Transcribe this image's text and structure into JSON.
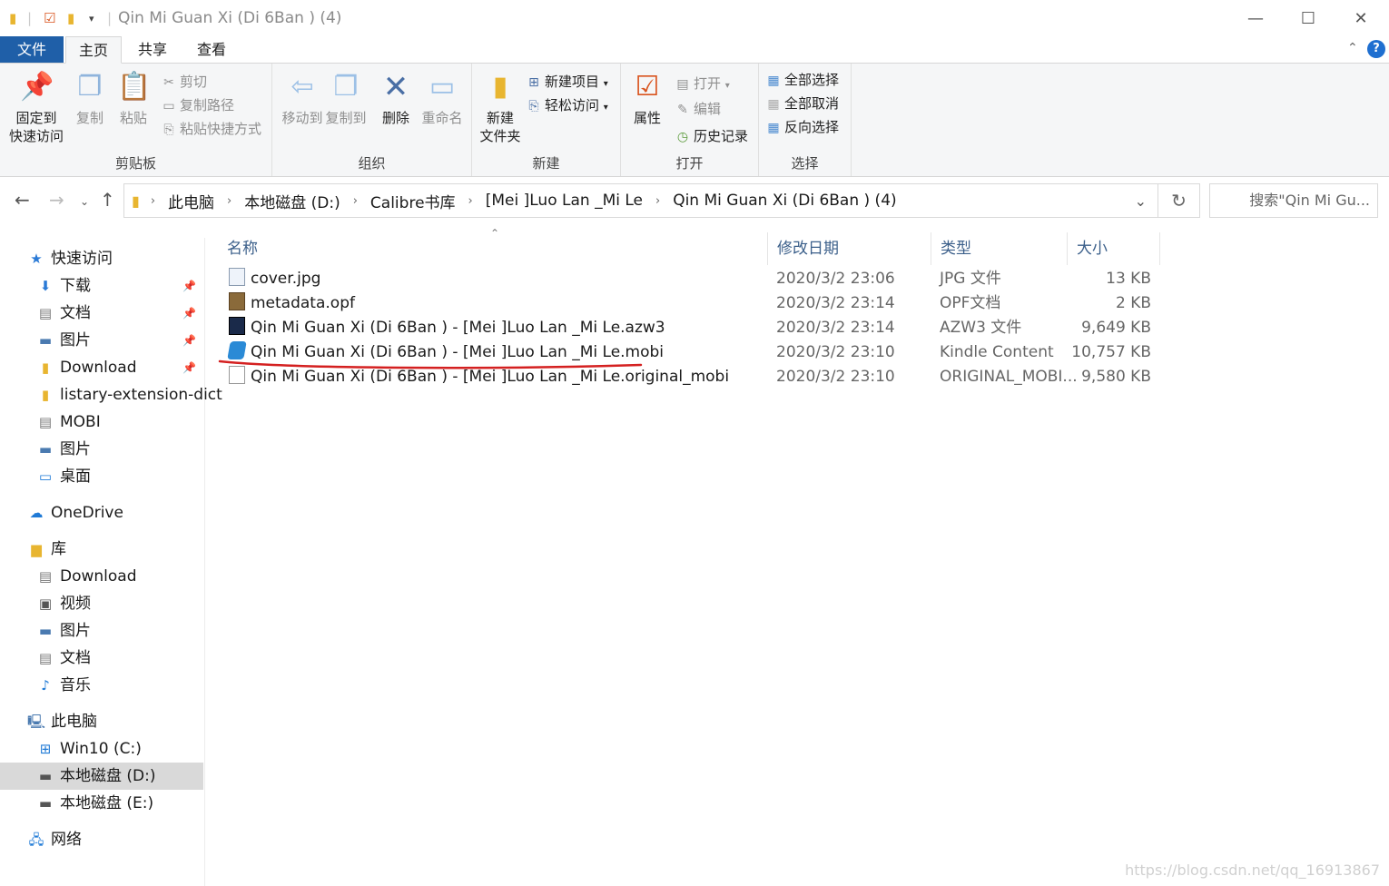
{
  "window": {
    "title": "Qin Mi Guan Xi (Di 6Ban ) (4)",
    "minimize": "—",
    "maximize": "☐",
    "close": "✕"
  },
  "tabs": {
    "file": "文件",
    "home": "主页",
    "share": "共享",
    "view": "查看"
  },
  "ribbon": {
    "clipboard": {
      "label": "剪贴板",
      "pin": "固定到\n快速访问",
      "copy": "复制",
      "paste": "粘贴",
      "cut": "剪切",
      "copy_path": "复制路径",
      "paste_shortcut": "粘贴快捷方式"
    },
    "organize": {
      "label": "组织",
      "move_to": "移动到",
      "copy_to": "复制到",
      "delete": "删除",
      "rename": "重命名"
    },
    "new": {
      "label": "新建",
      "new_folder": "新建\n文件夹",
      "new_item": "新建项目",
      "easy_access": "轻松访问"
    },
    "open": {
      "label": "打开",
      "properties": "属性",
      "open": "打开",
      "edit": "编辑",
      "history": "历史记录"
    },
    "select": {
      "label": "选择",
      "select_all": "全部选择",
      "select_none": "全部取消",
      "invert": "反向选择"
    }
  },
  "address": {
    "crumbs": [
      "此电脑",
      "本地磁盘 (D:)",
      "Calibre书库",
      "[Mei ]Luo Lan _Mi Le",
      "Qin Mi Guan Xi (Di 6Ban ) (4)"
    ],
    "search_placeholder": "搜索\"Qin Mi Gu..."
  },
  "nav": {
    "items": [
      {
        "label": "快速访问",
        "icon": "star-icon"
      },
      {
        "label": "下载",
        "icon": "download-arrow-icon"
      },
      {
        "label": "文档",
        "icon": "document-icon"
      },
      {
        "label": "图片",
        "icon": "picture-icon"
      },
      {
        "label": "Download",
        "icon": "folder-icon"
      },
      {
        "label": "listary-extension-dict",
        "icon": "folder-icon"
      },
      {
        "label": "MOBI",
        "icon": "document-icon"
      },
      {
        "label": "图片",
        "icon": "picture-icon"
      },
      {
        "label": "桌面",
        "icon": "desktop-icon"
      },
      {
        "label": "OneDrive",
        "icon": "cloud-icon"
      },
      {
        "label": "库",
        "icon": "library-icon"
      },
      {
        "label": "Download",
        "icon": "document-icon"
      },
      {
        "label": "视频",
        "icon": "video-icon"
      },
      {
        "label": "图片",
        "icon": "picture-icon"
      },
      {
        "label": "文档",
        "icon": "document-icon"
      },
      {
        "label": "音乐",
        "icon": "music-icon"
      },
      {
        "label": "此电脑",
        "icon": "computer-icon"
      },
      {
        "label": "Win10 (C:)",
        "icon": "windows-drive-icon"
      },
      {
        "label": "本地磁盘 (D:)",
        "icon": "drive-icon"
      },
      {
        "label": "本地磁盘 (E:)",
        "icon": "drive-icon"
      },
      {
        "label": "网络",
        "icon": "network-icon"
      }
    ]
  },
  "columns": {
    "name": "名称",
    "date": "修改日期",
    "type": "类型",
    "size": "大小"
  },
  "files": [
    {
      "name": "cover.jpg",
      "date": "2020/3/2 23:06",
      "type": "JPG 文件",
      "size": "13 KB",
      "icon": "image-file-icon"
    },
    {
      "name": "metadata.opf",
      "date": "2020/3/2 23:14",
      "type": "OPF文档",
      "size": "2 KB",
      "icon": "opf-file-icon"
    },
    {
      "name": "Qin Mi Guan Xi (Di 6Ban ) - [Mei ]Luo Lan _Mi Le.azw3",
      "date": "2020/3/2 23:14",
      "type": "AZW3 文件",
      "size": "9,649 KB",
      "icon": "kindle-file-icon"
    },
    {
      "name": "Qin Mi Guan Xi (Di 6Ban ) - [Mei ]Luo Lan _Mi Le.mobi",
      "date": "2020/3/2 23:10",
      "type": "Kindle Content",
      "size": "10,757 KB",
      "icon": "mobi-file-icon"
    },
    {
      "name": "Qin Mi Guan Xi (Di 6Ban ) - [Mei ]Luo Lan _Mi Le.original_mobi",
      "date": "2020/3/2 23:10",
      "type": "ORIGINAL_MOBI...",
      "size": "9,580 KB",
      "icon": "blank-file-icon"
    }
  ],
  "watermark": "https://blog.csdn.net/qq_16913867",
  "colors": {
    "accent": "#1f5fa8",
    "underline": "#d42020",
    "selected_nav": "#d9d9d9"
  }
}
